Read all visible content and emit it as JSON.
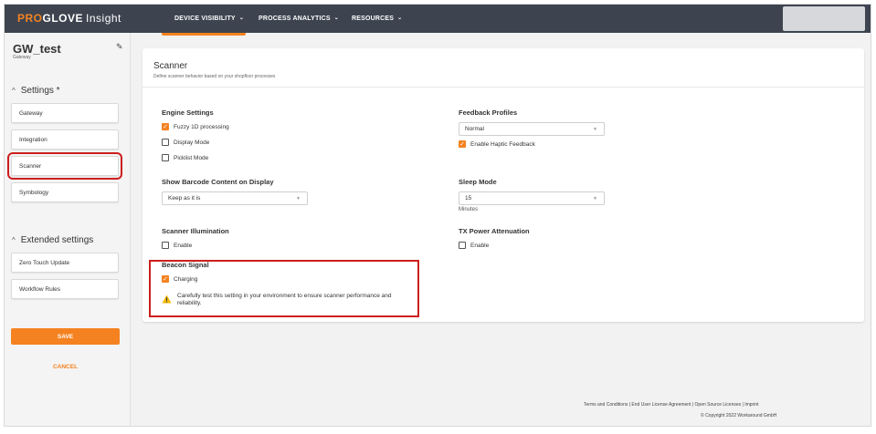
{
  "brand": {
    "pro": "PRO",
    "glove": "GLOVE",
    "insight": "Insight"
  },
  "nav": [
    {
      "label": "DEVICE VISIBILITY"
    },
    {
      "label": "PROCESS ANALYTICS"
    },
    {
      "label": "RESOURCES"
    }
  ],
  "sidebar": {
    "gateway_name": "GW_test",
    "gateway_type": "Gateway",
    "settings_heading": "Settings *",
    "settings_items": [
      "Gateway",
      "Integration",
      "Scanner",
      "Symbology"
    ],
    "extended_heading": "Extended settings",
    "extended_items": [
      "Zero Touch Update",
      "Workflow Rules"
    ],
    "save_label": "SAVE",
    "cancel_label": "CANCEL"
  },
  "scanner": {
    "title": "Scanner",
    "subtitle": "Define scanner behavior based on your shopfloor processes",
    "engine": {
      "heading": "Engine Settings",
      "options": [
        {
          "label": "Fuzzy 1D processing",
          "checked": true
        },
        {
          "label": "Display Mode",
          "checked": false
        },
        {
          "label": "Picklist Mode",
          "checked": false
        }
      ]
    },
    "feedback": {
      "heading": "Feedback Profiles",
      "selected": "Normal",
      "haptic_label": "Enable Haptic Feedback",
      "haptic_checked": true
    },
    "barcode_display": {
      "heading": "Show Barcode Content on Display",
      "selected": "Keep as it is"
    },
    "sleep": {
      "heading": "Sleep Mode",
      "selected": "15",
      "unit": "Minutes"
    },
    "illumination": {
      "heading": "Scanner Illumination",
      "enable_label": "Enable",
      "checked": false
    },
    "tx_power": {
      "heading": "TX Power Attenuation",
      "enable_label": "Enable",
      "checked": false
    },
    "beacon": {
      "heading": "Beacon Signal",
      "charging_label": "Charging",
      "checked": true,
      "warning": "Carefully test this setting in your environment to ensure scanner performance and reliability."
    }
  },
  "footer": {
    "links": "Terms and Conditions | End User License Agreement | Open Source Licenses | Imprint",
    "copyright": "© Copyright 2022 Workaround GmbH"
  },
  "colors": {
    "accent": "#f58220",
    "topbar": "#3d4450",
    "highlight": "#cc1f1f"
  }
}
